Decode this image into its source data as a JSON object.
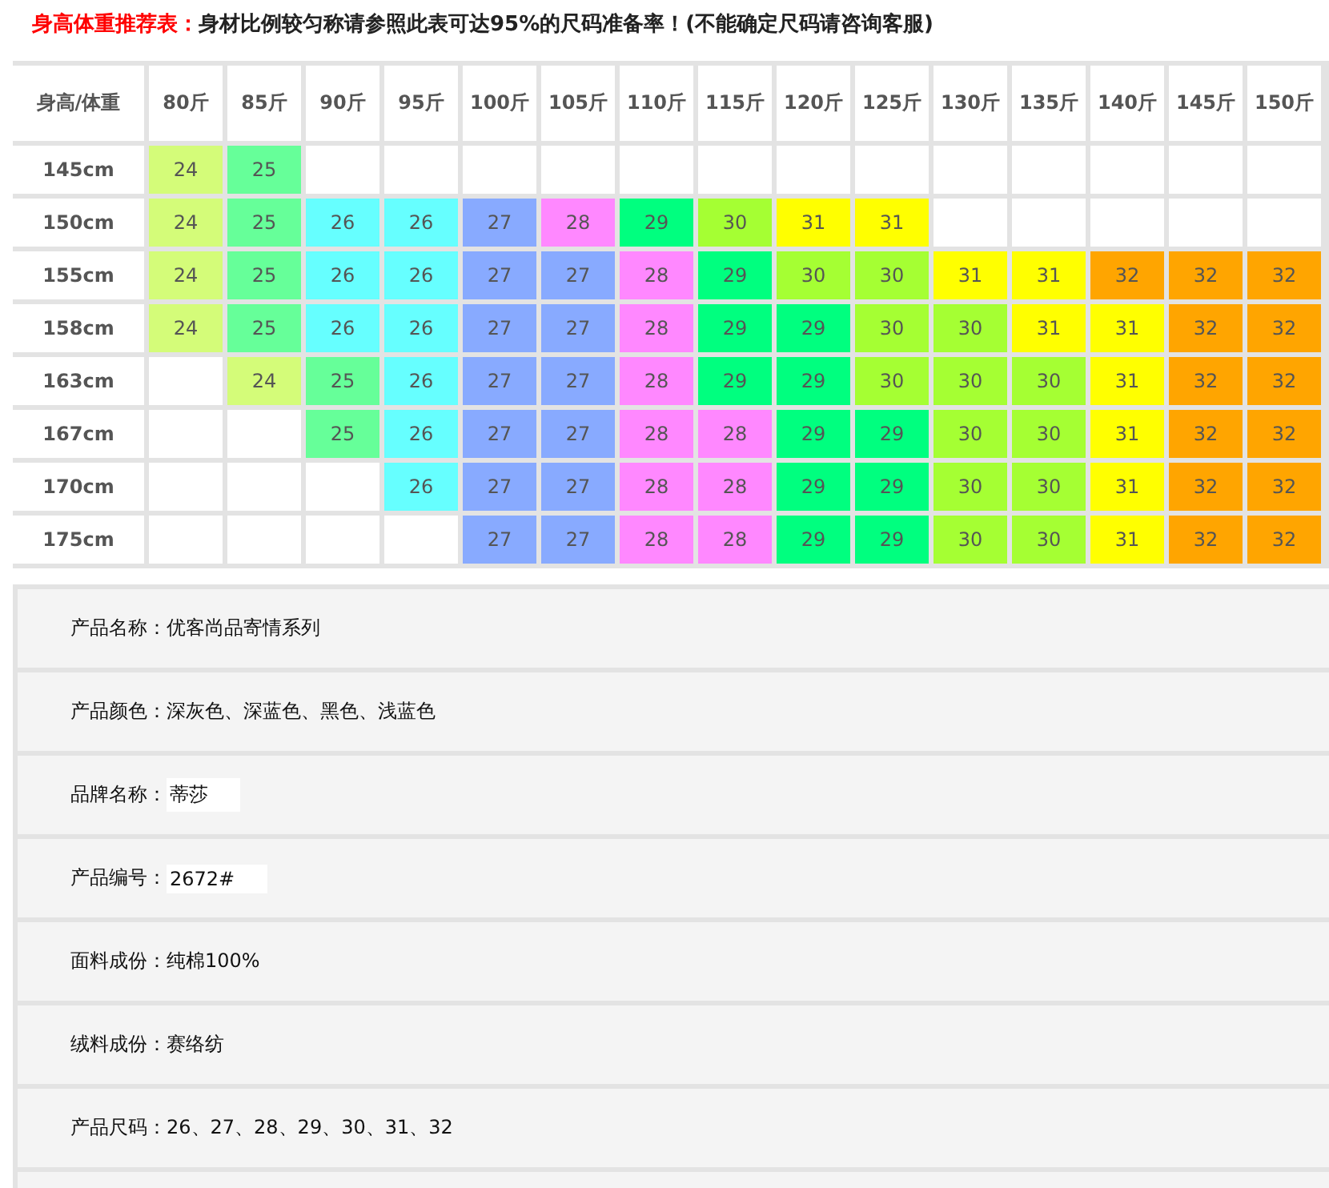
{
  "heading": {
    "title": "身高体重推荐表：",
    "note": "身材比例较匀称请参照此表可达95%的尺码准备率！(不能确定尺码请咨询客服)"
  },
  "table": {
    "corner": "身高/体重",
    "columns": [
      "80斤",
      "85斤",
      "90斤",
      "95斤",
      "100斤",
      "105斤",
      "110斤",
      "115斤",
      "120斤",
      "125斤",
      "130斤",
      "135斤",
      "140斤",
      "145斤",
      "150斤"
    ],
    "rows": [
      {
        "height": "145cm",
        "cells": [
          {
            "value": "24",
            "color": "#d4fc79"
          },
          {
            "value": "25",
            "color": "#66ff99"
          },
          null,
          null,
          null,
          null,
          null,
          null,
          null,
          null,
          null,
          null,
          null,
          null,
          null
        ]
      },
      {
        "height": "150cm",
        "cells": [
          {
            "value": "24",
            "color": "#d4fc79"
          },
          {
            "value": "25",
            "color": "#66ff99"
          },
          {
            "value": "26",
            "color": "#66ffff"
          },
          {
            "value": "26",
            "color": "#66ffff"
          },
          {
            "value": "27",
            "color": "#88aaff"
          },
          {
            "value": "28",
            "color": "#ff88ff"
          },
          {
            "value": "29",
            "color": "#00ff7f"
          },
          {
            "value": "30",
            "color": "#a5ff33"
          },
          {
            "value": "31",
            "color": "#ffff00"
          },
          {
            "value": "31",
            "color": "#ffff00"
          },
          null,
          null,
          null,
          null,
          null
        ]
      },
      {
        "height": "155cm",
        "cells": [
          {
            "value": "24",
            "color": "#d4fc79"
          },
          {
            "value": "25",
            "color": "#66ff99"
          },
          {
            "value": "26",
            "color": "#66ffff"
          },
          {
            "value": "26",
            "color": "#66ffff"
          },
          {
            "value": "27",
            "color": "#88aaff"
          },
          {
            "value": "27",
            "color": "#88aaff"
          },
          {
            "value": "28",
            "color": "#ff88ff"
          },
          {
            "value": "29",
            "color": "#00ff7f"
          },
          {
            "value": "30",
            "color": "#a5ff33"
          },
          {
            "value": "30",
            "color": "#a5ff33"
          },
          {
            "value": "31",
            "color": "#ffff00"
          },
          {
            "value": "31",
            "color": "#ffff00"
          },
          {
            "value": "32",
            "color": "#ffa500"
          },
          {
            "value": "32",
            "color": "#ffa500"
          },
          {
            "value": "32",
            "color": "#ffa500"
          }
        ]
      },
      {
        "height": "158cm",
        "cells": [
          {
            "value": "24",
            "color": "#d4fc79"
          },
          {
            "value": "25",
            "color": "#66ff99"
          },
          {
            "value": "26",
            "color": "#66ffff"
          },
          {
            "value": "26",
            "color": "#66ffff"
          },
          {
            "value": "27",
            "color": "#88aaff"
          },
          {
            "value": "27",
            "color": "#88aaff"
          },
          {
            "value": "28",
            "color": "#ff88ff"
          },
          {
            "value": "29",
            "color": "#00ff7f"
          },
          {
            "value": "29",
            "color": "#00ff7f"
          },
          {
            "value": "30",
            "color": "#a5ff33"
          },
          {
            "value": "30",
            "color": "#a5ff33"
          },
          {
            "value": "31",
            "color": "#ffff00"
          },
          {
            "value": "31",
            "color": "#ffff00"
          },
          {
            "value": "32",
            "color": "#ffa500"
          },
          {
            "value": "32",
            "color": "#ffa500"
          }
        ]
      },
      {
        "height": "163cm",
        "cells": [
          null,
          {
            "value": "24",
            "color": "#d4fc79"
          },
          {
            "value": "25",
            "color": "#66ff99"
          },
          {
            "value": "26",
            "color": "#66ffff"
          },
          {
            "value": "27",
            "color": "#88aaff"
          },
          {
            "value": "27",
            "color": "#88aaff"
          },
          {
            "value": "28",
            "color": "#ff88ff"
          },
          {
            "value": "29",
            "color": "#00ff7f"
          },
          {
            "value": "29",
            "color": "#00ff7f"
          },
          {
            "value": "30",
            "color": "#a5ff33"
          },
          {
            "value": "30",
            "color": "#a5ff33"
          },
          {
            "value": "30",
            "color": "#a5ff33"
          },
          {
            "value": "31",
            "color": "#ffff00"
          },
          {
            "value": "32",
            "color": "#ffa500"
          },
          {
            "value": "32",
            "color": "#ffa500"
          }
        ]
      },
      {
        "height": "167cm",
        "cells": [
          null,
          null,
          {
            "value": "25",
            "color": "#66ff99"
          },
          {
            "value": "26",
            "color": "#66ffff"
          },
          {
            "value": "27",
            "color": "#88aaff"
          },
          {
            "value": "27",
            "color": "#88aaff"
          },
          {
            "value": "28",
            "color": "#ff88ff"
          },
          {
            "value": "28",
            "color": "#ff88ff"
          },
          {
            "value": "29",
            "color": "#00ff7f"
          },
          {
            "value": "29",
            "color": "#00ff7f"
          },
          {
            "value": "30",
            "color": "#a5ff33"
          },
          {
            "value": "30",
            "color": "#a5ff33"
          },
          {
            "value": "31",
            "color": "#ffff00"
          },
          {
            "value": "32",
            "color": "#ffa500"
          },
          {
            "value": "32",
            "color": "#ffa500"
          }
        ]
      },
      {
        "height": "170cm",
        "cells": [
          null,
          null,
          null,
          {
            "value": "26",
            "color": "#66ffff"
          },
          {
            "value": "27",
            "color": "#88aaff"
          },
          {
            "value": "27",
            "color": "#88aaff"
          },
          {
            "value": "28",
            "color": "#ff88ff"
          },
          {
            "value": "28",
            "color": "#ff88ff"
          },
          {
            "value": "29",
            "color": "#00ff7f"
          },
          {
            "value": "29",
            "color": "#00ff7f"
          },
          {
            "value": "30",
            "color": "#a5ff33"
          },
          {
            "value": "30",
            "color": "#a5ff33"
          },
          {
            "value": "31",
            "color": "#ffff00"
          },
          {
            "value": "32",
            "color": "#ffa500"
          },
          {
            "value": "32",
            "color": "#ffa500"
          }
        ]
      },
      {
        "height": "175cm",
        "cells": [
          null,
          null,
          null,
          null,
          {
            "value": "27",
            "color": "#88aaff"
          },
          {
            "value": "27",
            "color": "#88aaff"
          },
          {
            "value": "28",
            "color": "#ff88ff"
          },
          {
            "value": "28",
            "color": "#ff88ff"
          },
          {
            "value": "29",
            "color": "#00ff7f"
          },
          {
            "value": "29",
            "color": "#00ff7f"
          },
          {
            "value": "30",
            "color": "#a5ff33"
          },
          {
            "value": "30",
            "color": "#a5ff33"
          },
          {
            "value": "31",
            "color": "#ffff00"
          },
          {
            "value": "32",
            "color": "#ffa500"
          },
          {
            "value": "32",
            "color": "#ffa500"
          }
        ]
      }
    ]
  },
  "details": [
    {
      "label": "产品名称：",
      "value": "优客尚品寄情系列",
      "highlighted": false
    },
    {
      "label": "产品颜色：",
      "value": "深灰色、深蓝色、黑色、浅蓝色",
      "highlighted": false
    },
    {
      "label": "品牌名称：",
      "value": "蒂莎",
      "highlighted": true
    },
    {
      "label": "产品编号：",
      "value": "2672#",
      "highlighted": true
    },
    {
      "label": "面料成份：",
      "value": "纯棉100%",
      "highlighted": false
    },
    {
      "label": "绒料成份：",
      "value": "赛络纺",
      "highlighted": false
    },
    {
      "label": "产品尺码：",
      "value": "26、27、28、29、30、31、32",
      "highlighted": false
    }
  ]
}
